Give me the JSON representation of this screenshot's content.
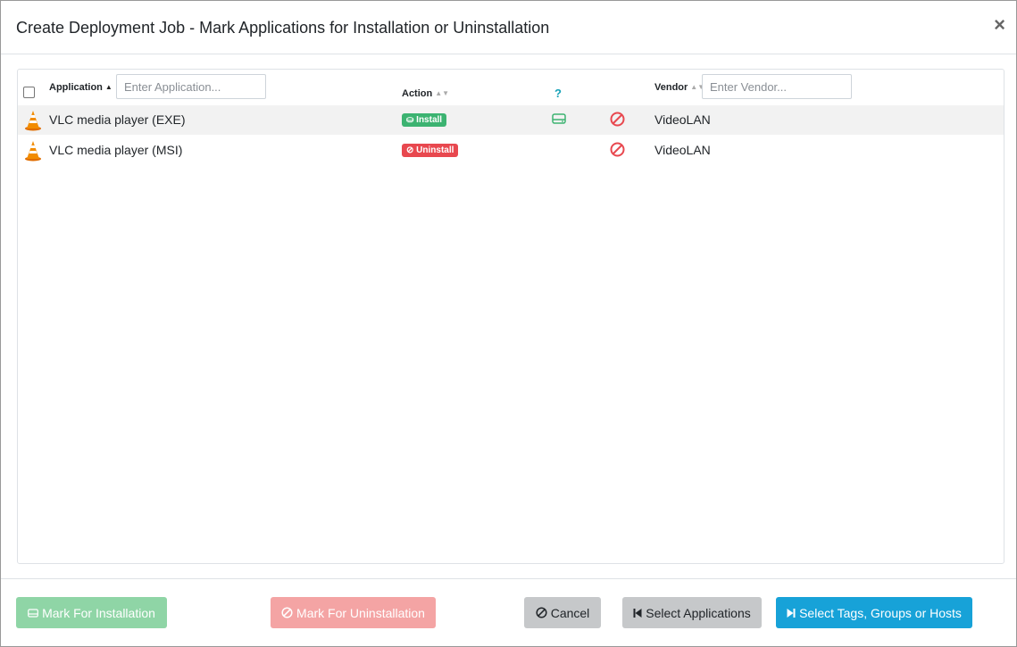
{
  "modal": {
    "title": "Create Deployment Job - Mark Applications for Installation or Uninstallation",
    "close_label": "×"
  },
  "table": {
    "headers": {
      "application": "Application",
      "action": "Action",
      "help": "?",
      "vendor": "Vendor"
    },
    "filters": {
      "application_placeholder": "Enter Application...",
      "vendor_placeholder": "Enter Vendor..."
    },
    "sort": {
      "application": "ascending"
    },
    "rows": [
      {
        "name": "VLC media player (EXE)",
        "action": "Install",
        "action_status": "install",
        "installable": true,
        "vendor": "VideoLAN"
      },
      {
        "name": "VLC media player (MSI)",
        "action": "Uninstall",
        "action_status": "uninstall",
        "installable": false,
        "vendor": "VideoLAN"
      }
    ]
  },
  "footer": {
    "mark_install_label": "Mark For Installation",
    "mark_uninstall_label": "Mark For Uninstallation",
    "cancel_label": "Cancel",
    "select_apps_label": "Select Applications",
    "select_targets_label": "Select Tags, Groups or Hosts"
  },
  "colors": {
    "install_green": "#3cb371",
    "uninstall_red": "#e8484f",
    "info_cyan": "#17a2b8",
    "primary_blue": "#17a2d8"
  },
  "icons": {
    "app_icon": "vlc-cone-icon",
    "install_icon": "hdd-icon",
    "uninstall_icon": "ban-icon",
    "cancel_icon": "ban-icon",
    "select_apps_icon": "step-backward-icon",
    "select_targets_icon": "step-forward-icon"
  }
}
